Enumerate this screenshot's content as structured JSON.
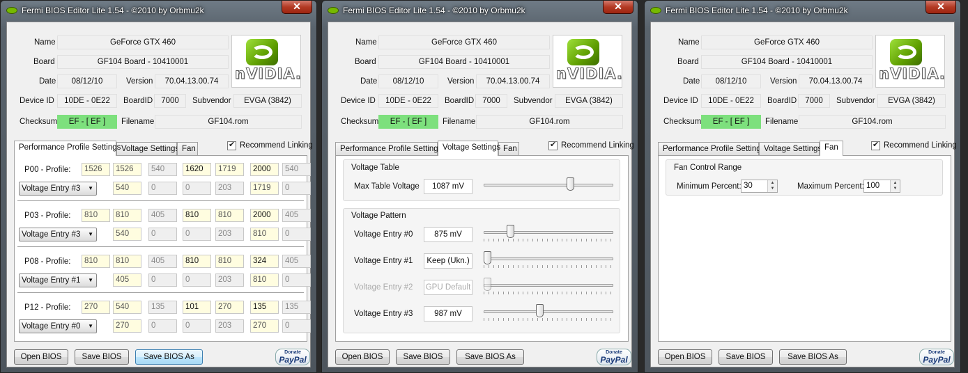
{
  "window": {
    "title": "Fermi BIOS Editor Lite 1.54 - ©2010 by Orbmu2k",
    "close": "✕"
  },
  "info": {
    "name_label": "Name",
    "name": "GeForce GTX 460",
    "board_label": "Board",
    "board": "GF104 Board - 10410001",
    "date_label": "Date",
    "date": "08/12/10",
    "version_label": "Version",
    "version": "70.04.13.00.74",
    "device_label": "Device ID",
    "device": "10DE - 0E22",
    "boardid_label": "BoardID",
    "boardid": "7000",
    "subvendor_label": "Subvendor",
    "subvendor": "EVGA (3842)",
    "checksum_label": "Checksum",
    "checksum": "EF - [ EF ]",
    "filename_label": "Filename",
    "filename": "GF104.rom",
    "logo_text": "nVIDIA."
  },
  "tabs": {
    "perf": "Performance Profile Settings",
    "voltage": "Voltage Settings",
    "fan": "Fan",
    "recommend": "Recommend Linking"
  },
  "profiles": [
    {
      "label": "P00 - Profile:",
      "entry": "Voltage Entry #3",
      "row1": [
        "1526",
        "1526",
        "540",
        "1620",
        "1719",
        "2000",
        "540"
      ],
      "row2": [
        "540",
        "0",
        "0",
        "203",
        "1719",
        "0"
      ]
    },
    {
      "label": "P03 - Profile:",
      "entry": "Voltage Entry #3",
      "row1": [
        "810",
        "810",
        "405",
        "810",
        "810",
        "2000",
        "405"
      ],
      "row2": [
        "540",
        "0",
        "0",
        "203",
        "810",
        "0"
      ]
    },
    {
      "label": "P08 - Profile:",
      "entry": "Voltage Entry #1",
      "row1": [
        "810",
        "810",
        "405",
        "810",
        "810",
        "324",
        "405"
      ],
      "row2": [
        "405",
        "0",
        "0",
        "203",
        "810",
        "0"
      ]
    },
    {
      "label": "P12 - Profile:",
      "entry": "Voltage Entry #0",
      "row1": [
        "270",
        "540",
        "135",
        "101",
        "270",
        "135",
        "135"
      ],
      "row2": [
        "270",
        "0",
        "0",
        "203",
        "270",
        "0"
      ]
    }
  ],
  "voltage": {
    "table_group": "Voltage Table",
    "max_label": "Max Table Voltage",
    "max_value": "1087 mV",
    "max_level": 0.68,
    "pattern_group": "Voltage Pattern",
    "entries": [
      {
        "label": "Voltage Entry #0",
        "value": "875 mV",
        "level": 0.19,
        "enabled": true
      },
      {
        "label": "Voltage Entry #1",
        "value": "Keep (Ukn.)",
        "level": 0.0,
        "enabled": true
      },
      {
        "label": "Voltage Entry #2",
        "value": "GPU Default",
        "level": 0.0,
        "enabled": false
      },
      {
        "label": "Voltage Entry #3",
        "value": "987 mV",
        "level": 0.43,
        "enabled": true
      }
    ]
  },
  "fan": {
    "group": "Fan Control Range",
    "min_label": "Minimum Percent:",
    "min_value": "30",
    "max_label": "Maximum Percent:",
    "max_value": "100"
  },
  "buttons": {
    "open": "Open BIOS",
    "save": "Save BIOS",
    "saveas": "Save BIOS As",
    "donate": "Donate",
    "paypal": "PayPal"
  }
}
